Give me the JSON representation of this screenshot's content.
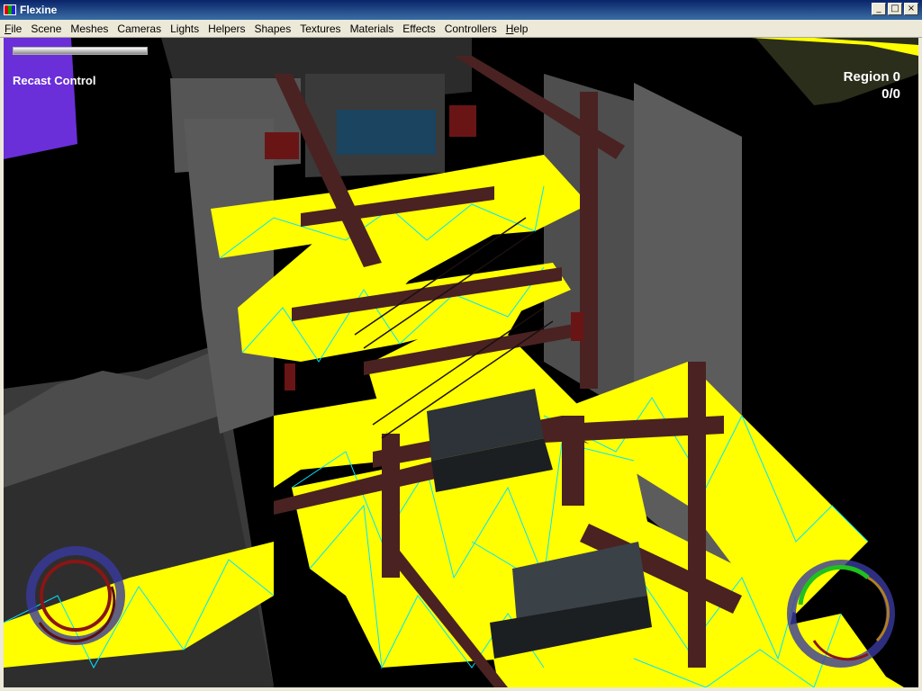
{
  "window": {
    "title": "Flexine"
  },
  "win_controls": {
    "minimize": "_",
    "maximize": "□",
    "close": "×"
  },
  "menu": [
    {
      "label": "File",
      "key": "F"
    },
    {
      "label": "Scene"
    },
    {
      "label": "Meshes"
    },
    {
      "label": "Cameras"
    },
    {
      "label": "Lights"
    },
    {
      "label": "Helpers"
    },
    {
      "label": "Shapes"
    },
    {
      "label": "Textures"
    },
    {
      "label": "Materials"
    },
    {
      "label": "Effects"
    },
    {
      "label": "Controllers"
    },
    {
      "label": "Help",
      "key": "H"
    }
  ],
  "hud": {
    "panel_label": "Recast Control",
    "region_label": "Region 0",
    "region_count": "0/0"
  },
  "colors": {
    "navmesh": "#ffff00",
    "navmesh_edges": "#00ffff",
    "wall": "#6a6a6a",
    "beam": "#4a2222",
    "title_bar": "#0a246a"
  }
}
